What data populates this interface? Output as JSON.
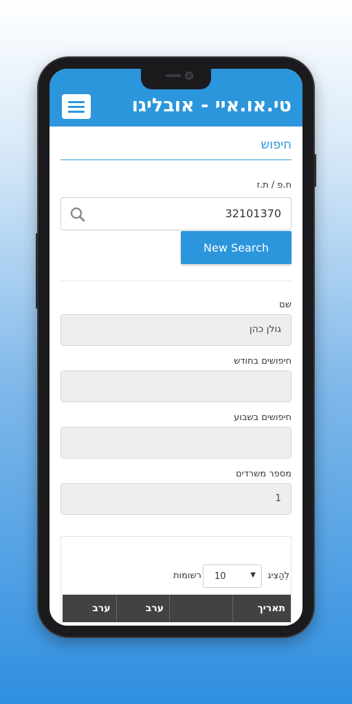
{
  "app": {
    "title": "טי.או.איי - אובליגו"
  },
  "icons": {
    "menu": "hamburger-menu-icon",
    "search": "search-icon",
    "select_arrow": "caret-down-icon"
  },
  "colors": {
    "primary": "#2b96dc",
    "table_header": "#424242"
  },
  "search": {
    "section_title": "חיפוש",
    "id_label": "ח.פ / ת.ז",
    "id_value": "32101370",
    "new_search_label": "New Search"
  },
  "details": {
    "name_label": "שם",
    "name_value": "גולן כהן",
    "monthly_label": "חיפושים בחודש",
    "monthly_value": "",
    "weekly_label": "חיפושים בשבוע",
    "weekly_value": "",
    "offices_label": "מספר משרדים",
    "offices_value": "1"
  },
  "table": {
    "show_label": "לְהַצִיג",
    "page_size": "10",
    "records_label": "רשומות",
    "columns": [
      "תאריך",
      "",
      "ערב",
      "ערב"
    ]
  }
}
